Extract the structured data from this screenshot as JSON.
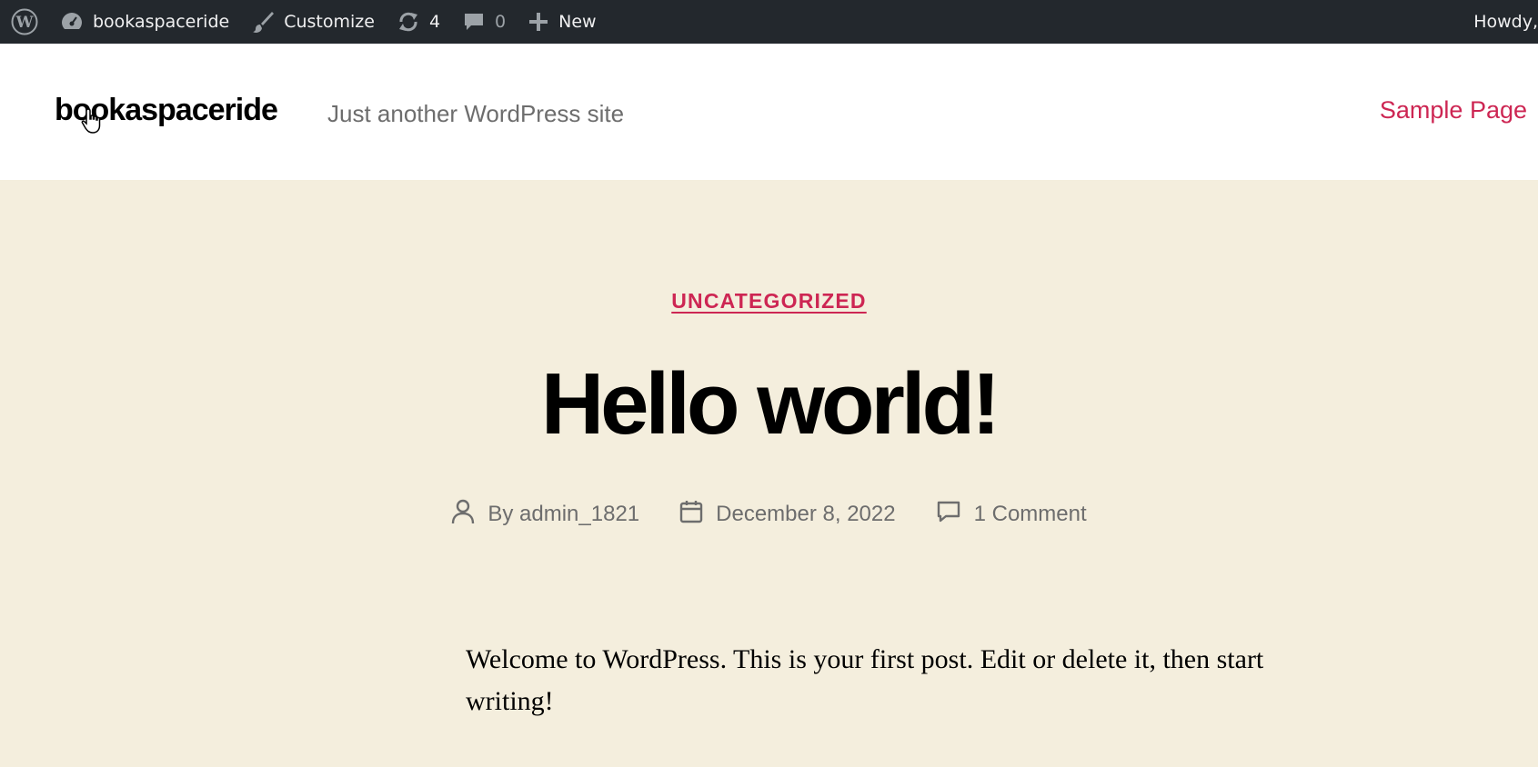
{
  "adminbar": {
    "site_name": "bookaspaceride",
    "customize_label": "Customize",
    "updates_count": "4",
    "comments_count": "0",
    "new_label": "New",
    "howdy": "Howdy,"
  },
  "header": {
    "site_title": "bookaspaceride",
    "tagline": "Just another WordPress site",
    "nav_items": [
      "Sample Page"
    ]
  },
  "post": {
    "category": "UNCATEGORIZED",
    "title": "Hello world!",
    "author": "By admin_1821",
    "date": "December 8, 2022",
    "comments": "1 Comment",
    "body": "Welcome to WordPress. This is your first post. Edit or delete it, then start writing!"
  },
  "colors": {
    "adminbar_bg": "#23282d",
    "accent": "#cd2653",
    "page_bg": "#f4eedd",
    "header_bg": "#ffffff"
  }
}
